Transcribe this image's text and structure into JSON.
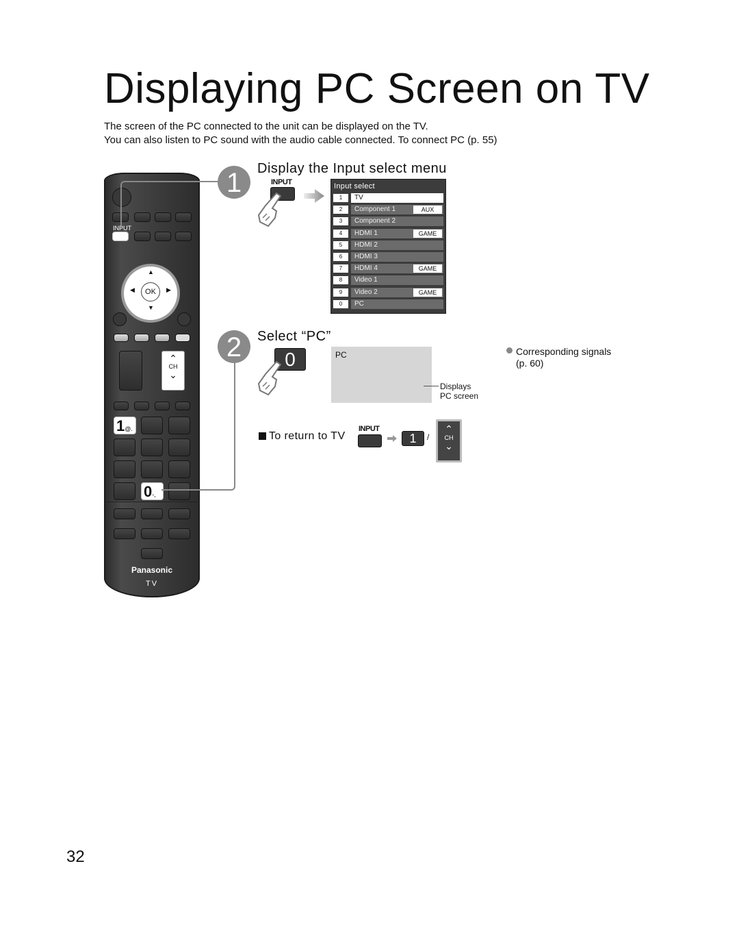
{
  "page": {
    "title": "Displaying PC Screen on TV",
    "intro": [
      "The screen of the PC connected to the unit can be displayed on the TV.",
      "You can also listen to PC sound with the audio cable connected. To connect PC (p. 55)"
    ],
    "page_number": "32"
  },
  "remote": {
    "input_label": "INPUT",
    "ok_label": "OK",
    "ch_label": "CH",
    "key_1": "1",
    "key_1_sub": "@.",
    "key_0": "0",
    "key_0_sub": "-,",
    "brand": "Panasonic",
    "model": "TV"
  },
  "steps": [
    {
      "number": "1",
      "title": "Display the Input select menu",
      "button_label": "INPUT"
    },
    {
      "number": "2",
      "title": "Select “PC”",
      "button_label": "0"
    }
  ],
  "input_select_menu": {
    "title": "Input select",
    "items": [
      {
        "num": "1",
        "label": "TV",
        "tag": "",
        "selected": true
      },
      {
        "num": "2",
        "label": "Component 1",
        "tag": "AUX",
        "selected": false
      },
      {
        "num": "3",
        "label": "Component 2",
        "tag": "",
        "selected": false
      },
      {
        "num": "4",
        "label": "HDMI 1",
        "tag": "GAME",
        "selected": false
      },
      {
        "num": "5",
        "label": "HDMI 2",
        "tag": "",
        "selected": false
      },
      {
        "num": "6",
        "label": "HDMI 3",
        "tag": "",
        "selected": false
      },
      {
        "num": "7",
        "label": "HDMI 4",
        "tag": "GAME",
        "selected": false
      },
      {
        "num": "8",
        "label": "Video 1",
        "tag": "",
        "selected": false
      },
      {
        "num": "9",
        "label": "Video 2",
        "tag": "GAME",
        "selected": false
      },
      {
        "num": "0",
        "label": "PC",
        "tag": "",
        "selected": false
      }
    ]
  },
  "pc_screen": {
    "label": "PC",
    "callout_line1": "Displays",
    "callout_line2": "PC screen"
  },
  "note": {
    "line1": "Corresponding signals",
    "line2": "(p. 60)"
  },
  "return_to_tv": {
    "label": "To return to TV",
    "input_label": "INPUT",
    "key_label": "1",
    "separator": "/",
    "ch_label": "CH"
  }
}
